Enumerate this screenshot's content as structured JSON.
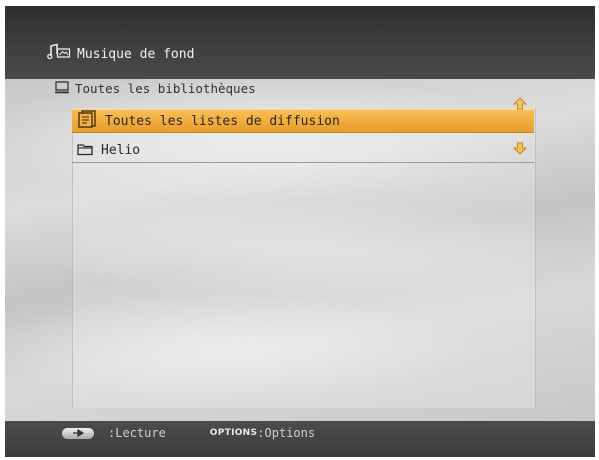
{
  "header": {
    "title": "Musique de fond",
    "icon": "music-note-icon"
  },
  "breadcrumb": {
    "label": "Toutes les bibliothèques",
    "icon": "library-icon"
  },
  "list": {
    "items": [
      {
        "label": "Toutes les listes de diffusion",
        "icon": "playlist-icon",
        "selected": true
      },
      {
        "label": "Helio",
        "icon": "folder-icon",
        "selected": false
      }
    ],
    "scroll_up_icon": "arrow-up-icon",
    "scroll_down_icon": "arrow-down-icon"
  },
  "footer": {
    "play_label": ":Lecture",
    "options_key": "OPTIONS",
    "options_label": ":Options"
  },
  "colors": {
    "selection": "#f0a93a",
    "top_bar": "#3a3a3a",
    "bottom_bar": "#424242",
    "background": "#d6d6d6"
  }
}
